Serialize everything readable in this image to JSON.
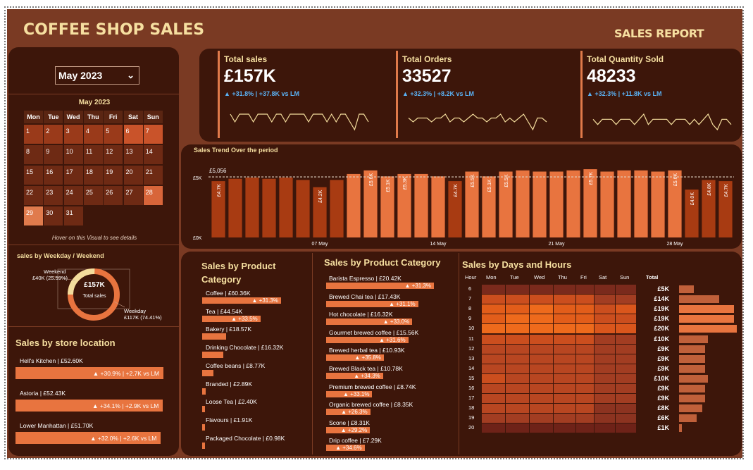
{
  "header": {
    "title": "COFFEE SHOP SALES",
    "subtitle": "SALES REPORT"
  },
  "filter": {
    "selected_month": "May 2023"
  },
  "calendar": {
    "title": "May 2023",
    "weekdays": [
      "Mon",
      "Tue",
      "Wed",
      "Thu",
      "Fri",
      "Sat",
      "Sun"
    ],
    "days": [
      "1",
      "2",
      "3",
      "4",
      "5",
      "6",
      "7",
      "8",
      "9",
      "10",
      "11",
      "12",
      "13",
      "14",
      "15",
      "16",
      "17",
      "18",
      "19",
      "20",
      "21",
      "22",
      "23",
      "24",
      "25",
      "26",
      "27",
      "28",
      "29",
      "30",
      "31"
    ],
    "hint": "Hover on this Visual to see details"
  },
  "weekday_weekend": {
    "title": "sales by Weekday / Weekend",
    "center_value": "£157K",
    "center_label": "Total sales",
    "weekend_label": "Weekend",
    "weekend_value": "£40K (25.59%)",
    "weekday_label": "Weekday",
    "weekday_value": "£117K (74.41%)",
    "weekend_pct": 25.59,
    "weekday_pct": 74.41
  },
  "store": {
    "title": "Sales by store location",
    "items": [
      {
        "label": "Hell's Kitchen | £52.60K",
        "delta": "▲ +30.9% | +2.7K vs LM",
        "value": 52.6
      },
      {
        "label": "Astoria | £52.43K",
        "delta": "▲ +34.1% | +2.9K vs LM",
        "value": 52.43
      },
      {
        "label": "Lower Manhattan | £51.70K",
        "delta": "▲ +32.0% | +2.6K vs LM",
        "value": 51.7
      }
    ]
  },
  "kpis": [
    {
      "label": "Total sales",
      "value": "£157K",
      "delta": "▲ +31.8% | +37.8K vs LM",
      "spark": [
        5,
        4,
        5,
        5,
        5,
        4,
        5,
        5,
        5,
        4,
        5,
        5,
        4,
        5,
        5,
        5,
        5,
        4,
        5,
        5,
        5,
        4,
        5,
        4,
        5,
        5,
        4,
        3,
        5,
        5,
        4
      ]
    },
    {
      "label": "Total Orders",
      "value": "33527",
      "delta": "▲ +32.3% | +8.2K vs LM",
      "spark": [
        5,
        4,
        5,
        5,
        5,
        4,
        5,
        5,
        6,
        4,
        5,
        5,
        4,
        5,
        6,
        5,
        5,
        4,
        5,
        5,
        6,
        4,
        5,
        4,
        5,
        6,
        4,
        2,
        5,
        5,
        4
      ]
    },
    {
      "label": "Total Quantity Sold",
      "value": "48233",
      "delta": "▲ +32.3% | +11.8K vs LM",
      "spark": [
        5,
        4,
        5,
        5,
        5,
        4,
        5,
        5,
        5,
        4,
        5,
        6,
        4,
        5,
        5,
        5,
        5,
        4,
        5,
        5,
        5,
        4,
        5,
        4,
        5,
        6,
        4,
        3,
        5,
        5,
        4
      ]
    }
  ],
  "trend": {
    "title": "Sales Trend Over the period",
    "avg_label": "£5,056",
    "avg_value": 5.056,
    "y_top_label": "£5K",
    "y_zero_label": "£0K",
    "x_labels": [
      "07 May",
      "14 May",
      "21 May",
      "28 May"
    ]
  },
  "chart_data": {
    "type": "bar",
    "title": "Sales Trend Over the period",
    "categories": [
      "1",
      "2",
      "3",
      "4",
      "5",
      "6",
      "7",
      "8",
      "9",
      "10",
      "11",
      "12",
      "13",
      "14",
      "15",
      "16",
      "17",
      "18",
      "19",
      "20",
      "21",
      "22",
      "23",
      "24",
      "25",
      "26",
      "27",
      "28",
      "29",
      "30",
      "31"
    ],
    "values": [
      4.7,
      4.9,
      5.0,
      4.9,
      5.0,
      4.8,
      4.2,
      4.8,
      5.3,
      5.6,
      5.1,
      5.3,
      5.3,
      5.1,
      4.7,
      5.5,
      5.1,
      5.5,
      5.6,
      5.5,
      5.5,
      5.6,
      5.7,
      5.5,
      5.6,
      5.6,
      5.5,
      5.6,
      4.0,
      4.8,
      4.7
    ],
    "data_labels": [
      "£4.7K",
      "",
      "",
      "",
      "",
      "",
      "£4.2K",
      "",
      "",
      "£5.6K",
      "£5.1K",
      "£5.3K",
      "",
      "",
      "£4.7K",
      "£5.5K",
      "£5.1K",
      "£5.5K",
      "",
      "",
      "",
      "",
      "£5.7K",
      "",
      "",
      "",
      "",
      "£5.6K",
      "£4.0K",
      "£4.8K",
      "£4.7K"
    ],
    "ylabel": "",
    "xlabel": "",
    "ylim": [
      0,
      6
    ]
  },
  "products_a": {
    "title": "Sales by Product Category",
    "items": [
      {
        "label": "Coffee | £60.36K",
        "delta": "▲ +31.3%",
        "value": 60.36
      },
      {
        "label": "Tea | £44.54K",
        "delta": "▲ +33.5%",
        "value": 44.54
      },
      {
        "label": "Bakery | £18.57K",
        "delta": "",
        "value": 18.57
      },
      {
        "label": "Drinking Chocolate | £16.32K",
        "delta": "",
        "value": 16.32
      },
      {
        "label": "Coffee beans | £8.77K",
        "delta": "",
        "value": 8.77
      },
      {
        "label": "Branded | £2.89K",
        "delta": "",
        "value": 2.89
      },
      {
        "label": "Loose Tea | £2.40K",
        "delta": "",
        "value": 2.4
      },
      {
        "label": "Flavours | £1.91K",
        "delta": "",
        "value": 1.91
      },
      {
        "label": "Packaged Chocolate | £0.98K",
        "delta": "",
        "value": 0.98
      }
    ]
  },
  "products_b": {
    "title": "Sales by Product Category",
    "items": [
      {
        "label": "Barista Espresso | £20.42K",
        "delta": "▲ +31.3%",
        "value": 20.42
      },
      {
        "label": "Brewed Chai tea | £17.43K",
        "delta": "▲ +31.1%",
        "value": 17.43
      },
      {
        "label": "Hot chocolate | £16.32K",
        "delta": "▲ +33.0%",
        "value": 16.32
      },
      {
        "label": "Gourmet brewed coffee | £15.56K",
        "delta": "▲ +31.6%",
        "value": 15.56
      },
      {
        "label": "Brewed herbal tea | £10.93K",
        "delta": "▲ +35.8%",
        "value": 10.93
      },
      {
        "label": "Brewed Black tea | £10.78K",
        "delta": "▲ +34.3%",
        "value": 10.78
      },
      {
        "label": "Premium brewed coffee | £8.74K",
        "delta": "▲ +33.1%",
        "value": 8.74
      },
      {
        "label": "Organic brewed coffee | £8.35K",
        "delta": "▲ +26.3%",
        "value": 8.35
      },
      {
        "label": "Scone | £8.31K",
        "delta": "▲ +29.2%",
        "value": 8.31
      },
      {
        "label": "Drip coffee | £7.29K",
        "delta": "▲ +34.6%",
        "value": 7.29
      }
    ]
  },
  "heatmap": {
    "title": "Sales by Days and Hours",
    "hour_header": "Hour",
    "total_header": "Total",
    "days": [
      "Mon",
      "Tue",
      "Wed",
      "Thu",
      "Fri",
      "Sat",
      "Sun"
    ],
    "hours": [
      "6",
      "7",
      "8",
      "9",
      "10",
      "11",
      "12",
      "13",
      "14",
      "15",
      "16",
      "17",
      "18",
      "19",
      "20"
    ],
    "totals": [
      "£5K",
      "£14K",
      "£19K",
      "£19K",
      "£20K",
      "£10K",
      "£9K",
      "£9K",
      "£9K",
      "£10K",
      "£9K",
      "£9K",
      "£8K",
      "£6K",
      "£1K"
    ],
    "total_values": [
      5,
      14,
      19,
      19,
      20,
      10,
      9,
      9,
      9,
      10,
      9,
      9,
      8,
      6,
      1
    ],
    "intensity": [
      [
        2,
        2,
        2,
        2,
        2,
        2,
        2
      ],
      [
        6,
        6,
        6,
        6,
        6,
        4,
        4
      ],
      [
        8,
        8,
        9,
        8,
        8,
        6,
        7
      ],
      [
        8,
        9,
        9,
        8,
        8,
        6,
        6
      ],
      [
        9,
        9,
        9,
        9,
        9,
        7,
        7
      ],
      [
        6,
        6,
        6,
        6,
        6,
        4,
        4
      ],
      [
        5,
        5,
        5,
        5,
        5,
        4,
        4
      ],
      [
        5,
        5,
        5,
        5,
        5,
        4,
        4
      ],
      [
        5,
        5,
        5,
        5,
        5,
        4,
        4
      ],
      [
        6,
        5,
        5,
        5,
        5,
        4,
        4
      ],
      [
        5,
        5,
        5,
        5,
        5,
        4,
        4
      ],
      [
        5,
        5,
        5,
        5,
        5,
        4,
        4
      ],
      [
        5,
        5,
        5,
        5,
        5,
        3,
        3
      ],
      [
        4,
        4,
        4,
        4,
        4,
        3,
        3
      ],
      [
        1,
        1,
        1,
        1,
        1,
        1,
        1
      ]
    ]
  }
}
